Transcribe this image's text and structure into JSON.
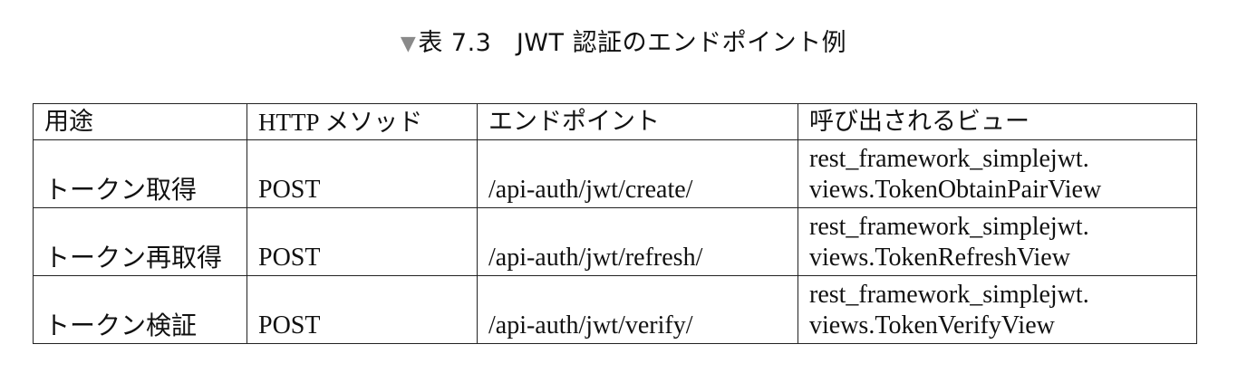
{
  "caption": {
    "marker": "▼",
    "text": "表 7.3　JWT 認証のエンドポイント例"
  },
  "table": {
    "headers": {
      "purpose": "用途",
      "method": "HTTP メソッド",
      "endpoint": "エンドポイント",
      "view": "呼び出されるビュー"
    },
    "rows": [
      {
        "purpose": "トークン取得",
        "method": "POST",
        "endpoint": "/api-auth/jwt/create/",
        "view_line1": "rest_framework_simplejwt.",
        "view_line2": "views.TokenObtainPairView"
      },
      {
        "purpose": "トークン再取得",
        "method": "POST",
        "endpoint": "/api-auth/jwt/refresh/",
        "view_line1": "rest_framework_simplejwt.",
        "view_line2": "views.TokenRefreshView"
      },
      {
        "purpose": "トークン検証",
        "method": "POST",
        "endpoint": "/api-auth/jwt/verify/",
        "view_line1": "rest_framework_simplejwt.",
        "view_line2": "views.TokenVerifyView"
      }
    ]
  }
}
